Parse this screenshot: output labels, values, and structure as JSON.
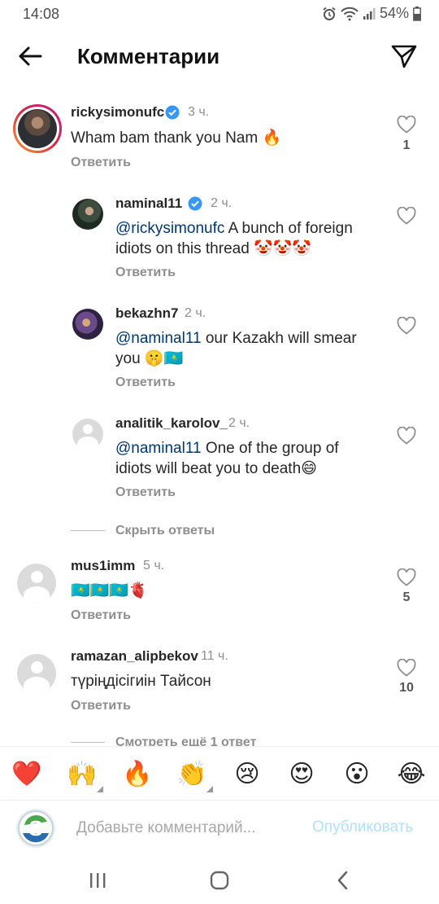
{
  "status_bar": {
    "time": "14:08",
    "battery": "54%"
  },
  "header": {
    "title": "Комментарии"
  },
  "comments": [
    {
      "username": "rickysimonufc",
      "verified": true,
      "time": "3 ч.",
      "text": "Wham bam thank you Nam 🔥",
      "reply_label": "Ответить",
      "likes": "1"
    },
    {
      "username": "naminal11",
      "verified": true,
      "time": "2 ч.",
      "mention": "@rickysimonufc",
      "text_line1": " A bunch of foreign",
      "text_line2": "idiots on this thread 🤡🤡🤡",
      "reply_label": "Ответить"
    },
    {
      "username": "bekazhn7",
      "verified": false,
      "time": "2 ч.",
      "mention": "@naminal11",
      "text_line1": " our Kazakh will smear",
      "text_line2": "you 🤫🇰🇿",
      "reply_label": "Ответить"
    },
    {
      "username": "analitik_karolov_",
      "verified": false,
      "time": "2 ч.",
      "mention": "@naminal11",
      "text_line1": " One of the group of",
      "text_line2": "idiots will beat you to death😄",
      "reply_label": "Ответить"
    },
    {
      "username": "mus1imm",
      "verified": false,
      "time": "5 ч.",
      "text": "🇰🇿🇰🇿🇰🇿🫀",
      "reply_label": "Ответить",
      "likes": "5"
    },
    {
      "username": "ramazan_alipbekov",
      "verified": false,
      "time": "11 ч.",
      "text": "түріңдісігиін Тайсон",
      "reply_label": "Ответить",
      "likes": "10"
    }
  ],
  "hide_replies": "Скрыть ответы",
  "view_more": "Смотреть ещё 1 ответ",
  "emoji_bar": [
    "❤️",
    "🙌",
    "🔥",
    "👏",
    "😢",
    "😍",
    "😮",
    "😂"
  ],
  "input": {
    "placeholder": "Добавьте комментарий...",
    "post_label": "Опубликовать"
  },
  "colors": {
    "verified": "#3897f0",
    "mention": "#00376b",
    "post_disabled": "#b2dffc",
    "story_ring_start": "#f09433",
    "story_ring_end": "#bc1888"
  },
  "icons": [
    "back-arrow-icon",
    "send-icon",
    "verified-badge-icon",
    "heart-outline-icon",
    "recent-apps-icon",
    "home-icon",
    "back-nav-icon"
  ]
}
